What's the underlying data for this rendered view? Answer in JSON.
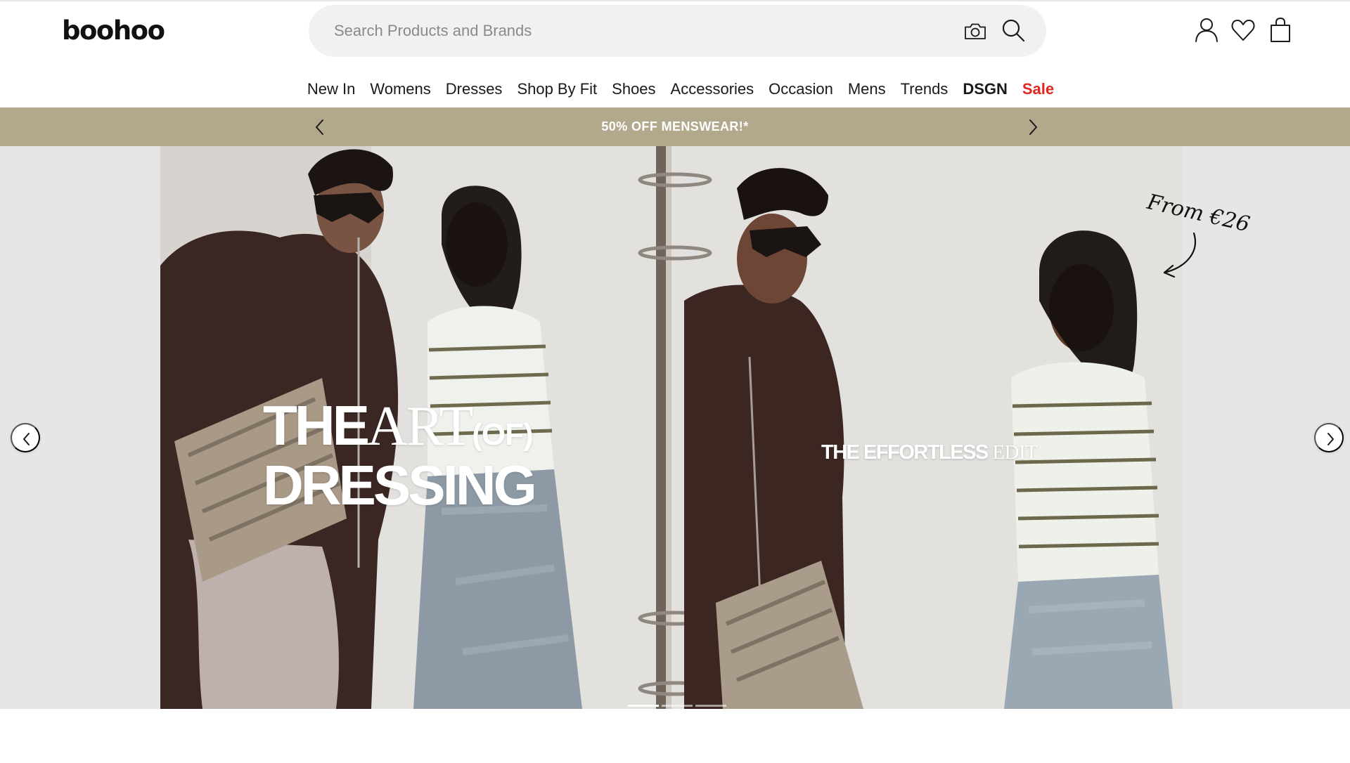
{
  "header": {
    "logo": "boohoo",
    "search": {
      "placeholder": "Search Products and Brands",
      "value": "",
      "camera_icon": "camera-icon",
      "search_icon": "search-icon"
    },
    "icons": [
      "account-icon",
      "wishlist-heart-icon",
      "shopping-bag-icon"
    ]
  },
  "nav": {
    "items": [
      {
        "label": "New In"
      },
      {
        "label": "Womens"
      },
      {
        "label": "Dresses"
      },
      {
        "label": "Shop By Fit"
      },
      {
        "label": "Shoes"
      },
      {
        "label": "Accessories"
      },
      {
        "label": "Occasion"
      },
      {
        "label": "Mens"
      },
      {
        "label": "Trends"
      },
      {
        "label": "DSGN"
      },
      {
        "label": "Sale"
      }
    ]
  },
  "promo": {
    "text": "50% OFF MENSWEAR!*",
    "background": "#b2a88c",
    "prev_icon": "chevron-left-icon",
    "next_icon": "chevron-right-icon"
  },
  "hero": {
    "headline": {
      "the": "THE",
      "art": "ART",
      "of": "(OF)",
      "dressing": "DRESSING"
    },
    "subline": {
      "bold": "THE EFFORTLESS ",
      "serif": "EDIT"
    },
    "price_note": "From €26",
    "prev_icon": "chevron-left-icon",
    "next_icon": "chevron-right-icon",
    "slides_total": 3,
    "slide_active": 1
  },
  "colors": {
    "sale": "#e0261f",
    "text": "#1a1a1a",
    "search_bg": "#f1f1f1"
  }
}
